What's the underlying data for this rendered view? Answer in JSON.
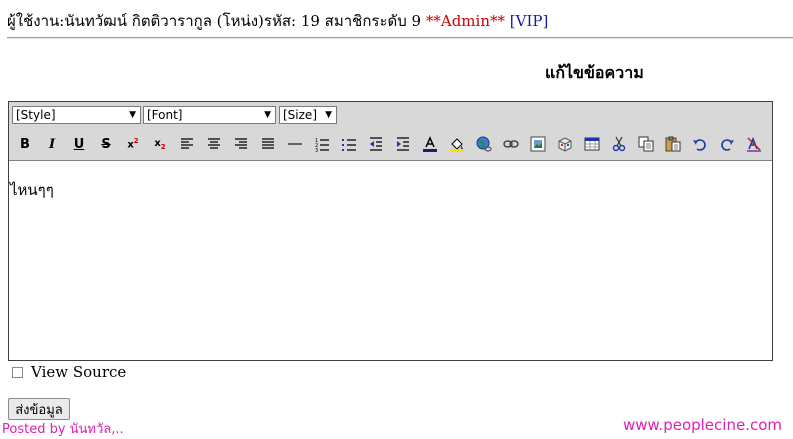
{
  "user_line": {
    "prefix": "ผู้ใช้งาน:นันทวัฒน์ กิตติวารากูล (โหน่ง)รหัส: 19 สมาชิกระดับ 9 ",
    "admin": "**Admin**",
    "vip": "[VIP]"
  },
  "page_title": "แก้ไขข้อความ",
  "editor": {
    "style_select": "[Style]",
    "font_select": "[Font]",
    "size_select": "[Size]",
    "content": "ไหนๆๆ",
    "toolbar_buttons": [
      "B",
      "I",
      "U",
      "S",
      "x²",
      "x₂",
      "align-left",
      "align-center",
      "align-right",
      "justify",
      "horizontal-rule",
      "ordered-list",
      "unordered-list",
      "outdent",
      "indent",
      "text-color",
      "highlight",
      "link-web",
      "link",
      "image",
      "table-insert",
      "table",
      "cut",
      "copy",
      "paste",
      "undo",
      "redo",
      "remove-format"
    ]
  },
  "view_source_label": "View Source",
  "submit_label": "ส่งข้อมูล",
  "footer": {
    "posted_by": "Posted by นันทวัล,..",
    "watermark": "www.peoplecine.com"
  },
  "colors": {
    "admin": "#cc0000",
    "vip": "#1a1aa6",
    "watermark": "#e020b0",
    "toolbar_bg": "#d8d8d8"
  }
}
